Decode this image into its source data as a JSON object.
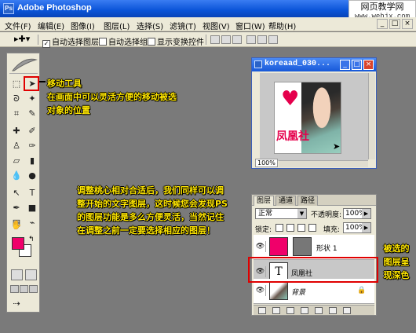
{
  "app": {
    "title": "Adobe Photoshop",
    "icon": "Ps"
  },
  "watermark": {
    "line1": "网页教学网",
    "line2": "www.webjx.com"
  },
  "menu": [
    "文件(F)",
    "编辑(E)",
    "图像(I)",
    "图层(L)",
    "选择(S)",
    "滤镜(T)",
    "视图(V)",
    "窗口(W)",
    "帮助(H)"
  ],
  "window_controls": [
    "_",
    "□",
    "×"
  ],
  "options": {
    "auto_select_layer": "自动选择图层",
    "auto_select_group": "自动选择组",
    "show_transform": "显示变换控件",
    "auto_select_layer_checked": true
  },
  "annotations": {
    "move_tool_title": "移动工具",
    "move_tool_desc": "在画面中可以灵活方便的移动被选对象的位置",
    "adjust_text": "调整桃心相对合适后，我们同样可以调整开始的文字图层，这时候您会发现PS的图层功能是多么方便灵活，当然记住在调整之前一定要选择相应的图层！",
    "selected_layer_note": "被选的图层呈现深色"
  },
  "document": {
    "title": "koreaad_030...",
    "zoom": "100%",
    "image_text": "凤凰社"
  },
  "layers_panel": {
    "tabs": [
      "图层",
      "通道",
      "路径"
    ],
    "blend_mode": "正常",
    "opacity_label": "不透明度:",
    "opacity": "100%",
    "lock_label": "锁定:",
    "fill_label": "填充:",
    "fill": "100%",
    "layers": [
      {
        "name": "形状 1",
        "type": "shape",
        "selected": false
      },
      {
        "name": "凤凰社",
        "type": "text",
        "thumb": "T",
        "selected": true
      },
      {
        "name": "背景",
        "type": "image",
        "selected": false
      }
    ]
  },
  "colors": {
    "foreground": "#f0006a",
    "background": "#ffffff",
    "annotation": "#ffe600",
    "highlight": "#e00000"
  }
}
